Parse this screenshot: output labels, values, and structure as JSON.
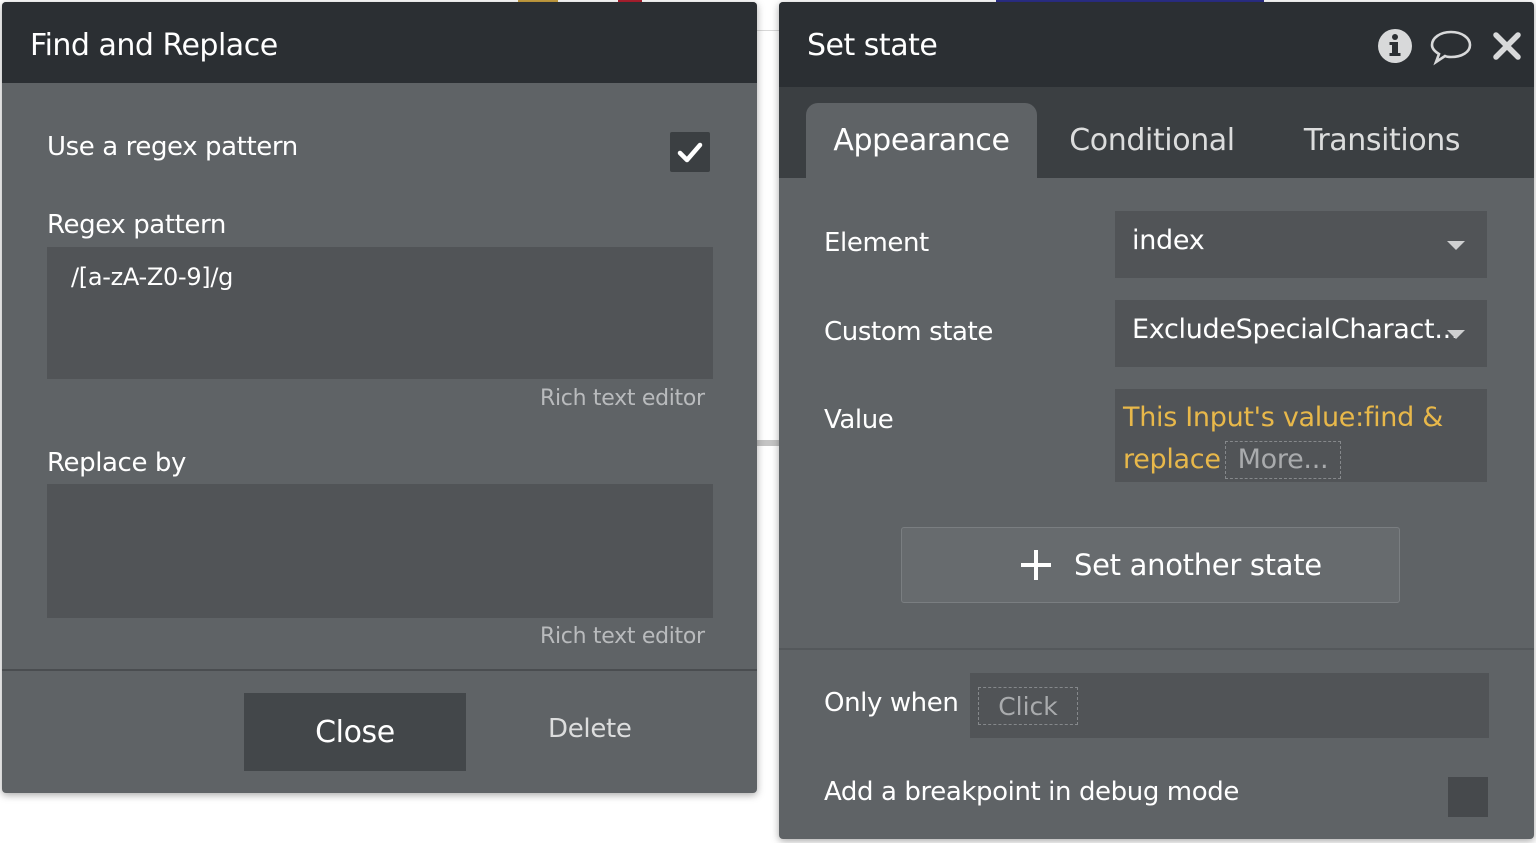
{
  "find_replace": {
    "title": "Find and Replace",
    "use_regex_label": "Use a regex pattern",
    "use_regex_checked": true,
    "regex_label": "Regex pattern",
    "regex_value": "/[a-zA-Z0-9]/g",
    "regex_hint": "Rich text editor",
    "replace_label": "Replace by",
    "replace_value": "",
    "replace_hint": "Rich text editor",
    "close_label": "Close",
    "delete_label": "Delete"
  },
  "set_state": {
    "title": "Set state",
    "icons": [
      "info-icon",
      "comment-icon",
      "close-icon"
    ],
    "tabs": [
      {
        "label": "Appearance",
        "active": true
      },
      {
        "label": "Conditional",
        "active": false
      },
      {
        "label": "Transitions",
        "active": false
      }
    ],
    "element_label": "Element",
    "element_value": "index",
    "custom_state_label": "Custom state",
    "custom_state_value": "ExcludeSpecialCharact...",
    "value_label": "Value",
    "value_expr_line1": "This Input's value:find &",
    "value_expr_line2": "replace",
    "value_more": "More...",
    "add_state_label": "Set another state",
    "only_when_label": "Only when",
    "only_when_placeholder": "Click",
    "breakpoint_label": "Add a breakpoint in debug mode",
    "breakpoint_checked": false
  },
  "colors": {
    "header_bg": "#2b2f33",
    "panel_bg": "#5f6366",
    "field_bg": "#515457",
    "expression": "#e8b84a"
  }
}
